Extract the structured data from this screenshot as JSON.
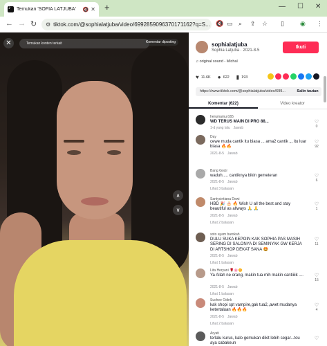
{
  "browser": {
    "tab_title": "Temukan 'SOFIA LATJUBA'",
    "url": "tiktok.com/@sophialatjuba/video/6992859096370171162?q=S..."
  },
  "video": {
    "search_placeholder": "Temukan konten terkait",
    "report_label": "Komentar diposting"
  },
  "creator": {
    "username": "sophialatjuba",
    "subtitle": "Sophia Latjuba · 2021-8-5",
    "follow_label": "Ikuti",
    "music": "original sound - Michal"
  },
  "stats": {
    "likes": "11.6K",
    "comments": "622",
    "saves": "193"
  },
  "share": {
    "url": "https://www.tiktok.com/@sophialatjuba/video/699...",
    "copy_label": "Salin tautan",
    "colors": [
      "#f5c518",
      "#fe2c55",
      "#fe2c55",
      "#25d366",
      "#1877f2",
      "#1da1f2",
      "#161823"
    ]
  },
  "tabs": {
    "comments": "Komentar (622)",
    "creator_videos": "Video kreator"
  },
  "comments": [
    {
      "user": "herumamur165",
      "text": "WD TERUS MAIN DI PRO 88...",
      "bold": true,
      "date": "1-d yang lalu",
      "reply": "Jawab",
      "likes": "0",
      "replies": "",
      "avatar": "#2b2b2b"
    },
    {
      "user": "Day",
      "text": "cewe muda cantik itu biasa ... ama2 cantik ,,, itu luar biasa 🔥🔥",
      "bold": false,
      "date": "2021-8-5",
      "reply": "Jawab",
      "likes": "92",
      "replies": "",
      "avatar": "#7b6a5e"
    },
    {
      "user": "Bang Gocir",
      "text": "waduh..... cantiknya bikin gemeteran",
      "bold": false,
      "date": "2021-8-5",
      "reply": "Jawab",
      "likes": "6",
      "replies": "Lihat 3 balasan",
      "avatar": "#a9a9a9"
    },
    {
      "user": "Santycintiana Dewi",
      "text": "HBD 🎉 🎂 🔥 Wish U all the best and stay beautiful as allways 🙏 🙏",
      "bold": false,
      "date": "2021-8-5",
      "reply": "Jawab",
      "likes": "1",
      "replies": "Lihat 2 balasan",
      "avatar": "#c08a6a"
    },
    {
      "user": "soto ayam barokah",
      "text": "DULU SUKA KEPOIN KAK SOPHIA PAS MASIH SERING DI SALONYA DI SEMINYAK GW KERJA DI ARTSHOP DEKAT SANA 🤩",
      "bold": false,
      "date": "2021-8-5",
      "reply": "Jawab",
      "likes": "11",
      "replies": "Lihat 1 balasan",
      "avatar": "#6e5e52"
    },
    {
      "user": "Lita Heryani 🌹🌸🌼",
      "text": "Ya Allah ne orang, makin tua mih makin cantiiiik ....",
      "bold": false,
      "date": "2021-8-5",
      "reply": "Jawab",
      "likes": "15",
      "replies": "Lihat 1 balasan",
      "avatar": "#b79a8a"
    },
    {
      "user": "Suchee Odink",
      "text": "kak shopi spt vampire,gak tua2,,awet mudanya ketertaluan 🔥🔥🔥",
      "bold": false,
      "date": "2021-8-5",
      "reply": "Jawab",
      "likes": "4",
      "replies": "Lihat 2 balasan",
      "avatar": "#c98a7a"
    },
    {
      "user": "Aryati",
      "text": "terlalu kurus, kalo gemukan dikit lebih segar...tou aya cabakeun",
      "bold": false,
      "date": "2021-8-6",
      "reply": "Jawab",
      "likes": "",
      "replies": "",
      "avatar": "#5b5b5b"
    }
  ]
}
